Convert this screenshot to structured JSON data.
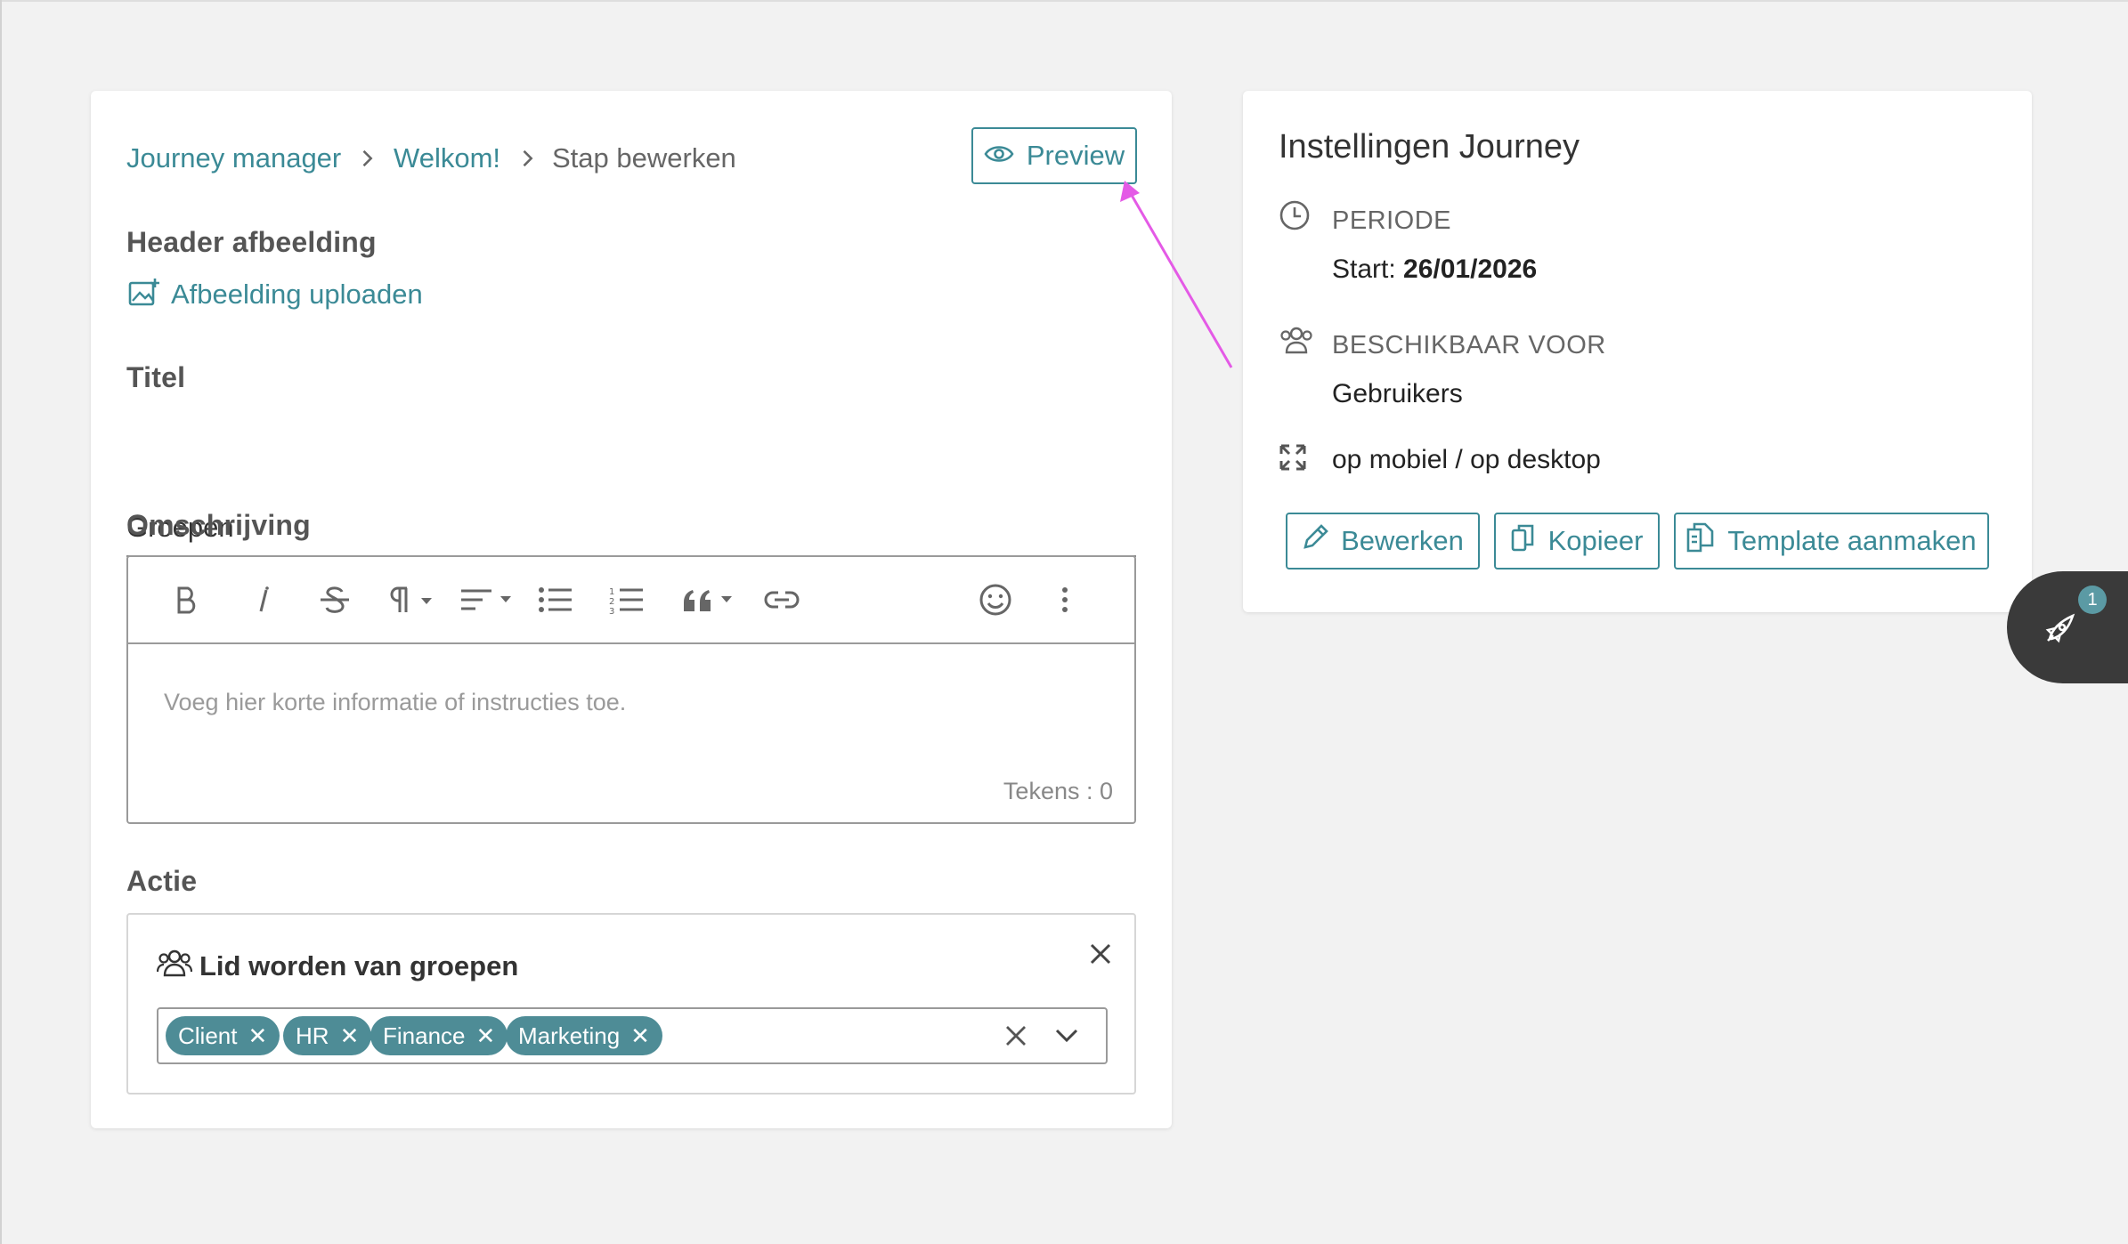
{
  "breadcrumb": {
    "items": [
      "Journey manager",
      "Welkom!",
      "Stap bewerken"
    ]
  },
  "preview_button": "Preview",
  "header_image": {
    "label": "Header afbeelding",
    "upload_link": "Afbeelding uploaden"
  },
  "title_field": {
    "label": "Titel",
    "value": "Groepen"
  },
  "description": {
    "label": "Omschrijving",
    "placeholder": "Voeg hier korte informatie of instructies toe.",
    "char_count": "Tekens : 0",
    "toolbar": [
      "bold-icon",
      "italic-icon",
      "strikethrough-icon",
      "paragraph-icon",
      "align-icon",
      "bullet-list-icon",
      "numbered-list-icon",
      "quote-icon",
      "link-icon",
      "emoji-icon",
      "more-vertical-icon"
    ]
  },
  "action": {
    "label": "Actie",
    "title": "Lid worden van groepen",
    "chips": [
      "Client",
      "HR",
      "Finance",
      "Marketing"
    ]
  },
  "settings": {
    "title": "Instellingen Journey",
    "period_label": "PERIODE",
    "period_prefix": "Start:",
    "period_value": "26/01/2026",
    "available_label": "BESCHIKBAAR VOOR",
    "available_value": "Gebruikers",
    "device_value": "op mobiel / op desktop",
    "buttons": {
      "edit": "Bewerken",
      "copy": "Kopieer",
      "template": "Template aanmaken"
    }
  },
  "fab": {
    "badge": "1",
    "icon": "rocket-icon"
  },
  "colors": {
    "accent": "#3b8a96",
    "chip": "#4e8c96",
    "annotation_arrow": "#e45ae6"
  }
}
